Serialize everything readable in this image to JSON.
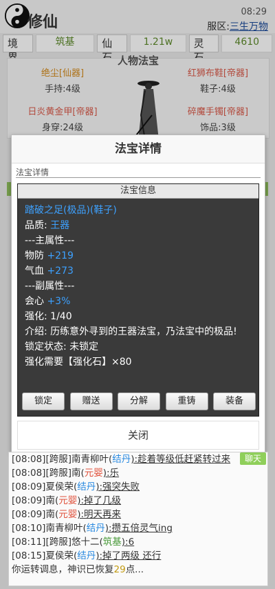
{
  "header": {
    "title": "修仙",
    "time": "08:29",
    "server_label": "服区:",
    "server_name": "三生万物"
  },
  "stats": [
    {
      "label": "境界",
      "value": "筑基"
    },
    {
      "label": "仙石",
      "value": "1.21w"
    },
    {
      "label": "灵石",
      "value": "4610"
    }
  ],
  "equipment": {
    "title": "人物法宝",
    "items": [
      {
        "name": "绝尘[仙器]",
        "slot": "手持:4级"
      },
      {
        "name": "红狮布鞋[帝器]",
        "slot": "鞋子:4级"
      },
      {
        "name": "日炎黄金甲[帝器]",
        "slot": "身穿:24级"
      },
      {
        "name": "碎魔手镯[帝器]",
        "slot": "饰品:3级"
      }
    ]
  },
  "dialog": {
    "title": "法宝详情",
    "subtitle": "法宝详情",
    "info_header": "法宝信息",
    "item_name": "踏破之足(极品)(鞋子)",
    "quality_label": "品质:",
    "quality_value": "王器",
    "main_attr_header": "---主属性---",
    "def_label": "物防",
    "def_value": "+219",
    "hp_label": "气血",
    "hp_value": "+273",
    "sub_attr_header": "---副属性---",
    "crit_label": "会心",
    "crit_value": "+3%",
    "enhance": "强化: 1/40",
    "intro": "介绍: 历练意外寻到的王器法宝，乃法宝中的极品!",
    "lock_status": "锁定状态: 未锁定",
    "enhance_need": "强化需要【强化石】×80",
    "buttons": [
      "锁定",
      "赠送",
      "分解",
      "重铸",
      "装备"
    ],
    "close_label": "关闭"
  },
  "chat": {
    "button_label": "聊天",
    "lines": [
      {
        "time": "[08:08]",
        "prefix": "[跨服]南青柳叶(",
        "rank": "结丹",
        "rank_color": "blue",
        "msg": "):趁着等级低赶紧转过来"
      },
      {
        "time": "[08:08]",
        "prefix": "[跨服]南(",
        "rank": "元婴",
        "rank_color": "red",
        "msg": "):乐"
      },
      {
        "time": "[08:09]",
        "prefix": "夏侯荣(",
        "rank": "结丹",
        "rank_color": "blue",
        "msg": "):强突失败"
      },
      {
        "time": "[08:09]",
        "prefix": "南(",
        "rank": "元婴",
        "rank_color": "red",
        "msg": "):掉了几级"
      },
      {
        "time": "[08:09]",
        "prefix": "南(",
        "rank": "元婴",
        "rank_color": "red",
        "msg": "):明天再来"
      },
      {
        "time": "[08:10]",
        "prefix": "南青柳叶(",
        "rank": "结丹",
        "rank_color": "blue",
        "msg": "):攒五倍灵气ing"
      },
      {
        "time": "[08:11]",
        "prefix": "[跨服]悠十二(",
        "rank": "筑基",
        "rank_color": "green",
        "msg": "):6"
      },
      {
        "time": "[08:15]",
        "prefix": "夏侯荣(",
        "rank": "结丹",
        "rank_color": "blue",
        "msg": "):掉了两级 还行"
      }
    ],
    "status_prefix": "你运转调息，神识已恢复",
    "status_value": "29",
    "status_suffix": "点..."
  }
}
